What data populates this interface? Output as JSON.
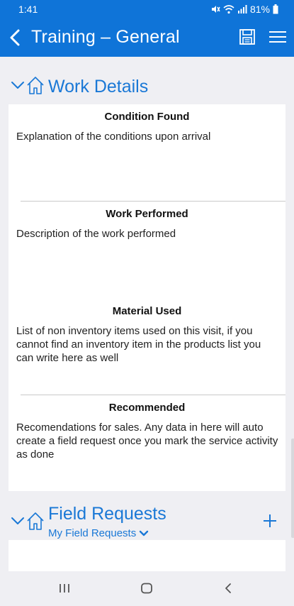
{
  "status_bar": {
    "time": "1:41",
    "battery": "81%"
  },
  "app_bar": {
    "title": "Training – General",
    "icons": [
      "back-arrow-icon",
      "save-icon",
      "menu-icon"
    ]
  },
  "work_details": {
    "title": "Work Details",
    "fields": [
      {
        "label": "Condition Found",
        "value": "Explanation of the conditions upon arrival"
      },
      {
        "label": "Work Performed",
        "value": "Description of the work performed"
      },
      {
        "label": "Material Used",
        "value": "List of non inventory items used on this visit, if you cannot find an inventory item in the products list you can write here as well"
      },
      {
        "label": "Recommended",
        "value": "Recomendations for sales. Any data in here will auto create a field request once you mark the service activity as done"
      }
    ]
  },
  "field_requests": {
    "title": "Field Requests",
    "filter": "My Field Requests"
  },
  "colors": {
    "brand": "#0f74d8",
    "accent": "#1a78d6",
    "background": "#efeff3"
  }
}
